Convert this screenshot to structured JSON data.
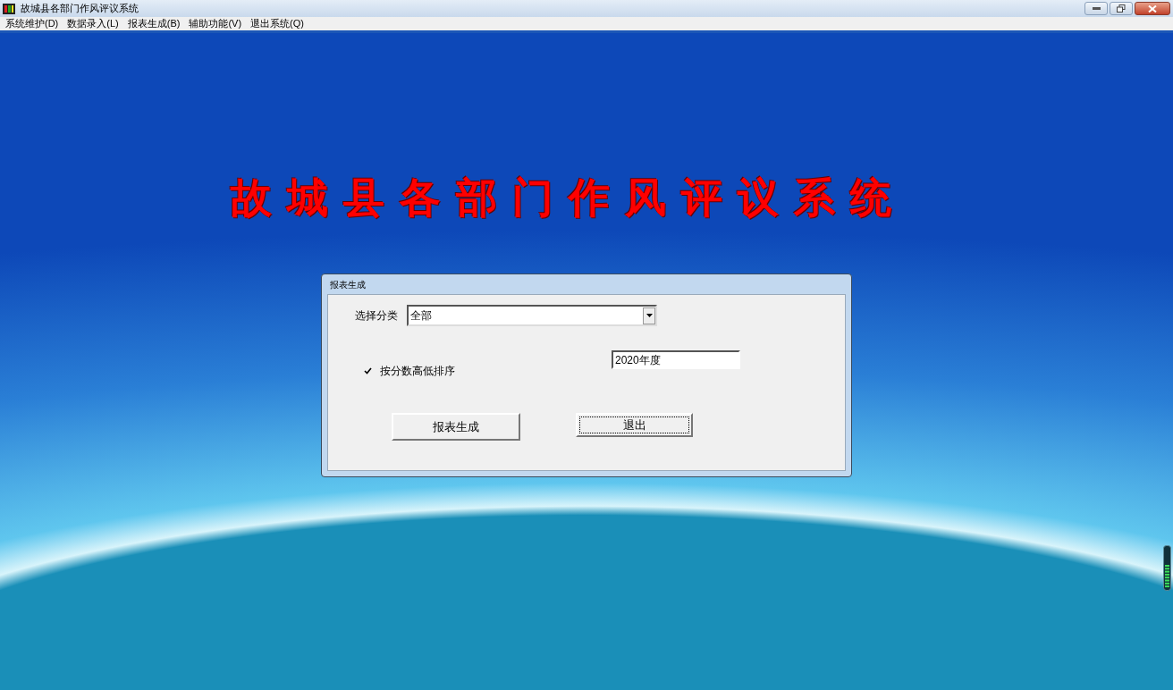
{
  "window": {
    "title": "故城县各部门作风评议系统"
  },
  "menu": [
    {
      "label": "系统维护(D)"
    },
    {
      "label": "数据录入(L)"
    },
    {
      "label": "报表生成(B)"
    },
    {
      "label": "辅助功能(V)"
    },
    {
      "label": "退出系统(Q)"
    }
  ],
  "heading": "故城县各部门作风评议系统",
  "dialog": {
    "title": "报表生成",
    "category": {
      "label": "选择分类",
      "value": "全部"
    },
    "sort_checkbox": {
      "label": "按分数高低排序",
      "checked": true
    },
    "year_field": {
      "value": "2020年度"
    },
    "buttons": [
      {
        "label": "报表生成",
        "focused": false
      },
      {
        "label": "退出",
        "focused": true
      }
    ]
  }
}
